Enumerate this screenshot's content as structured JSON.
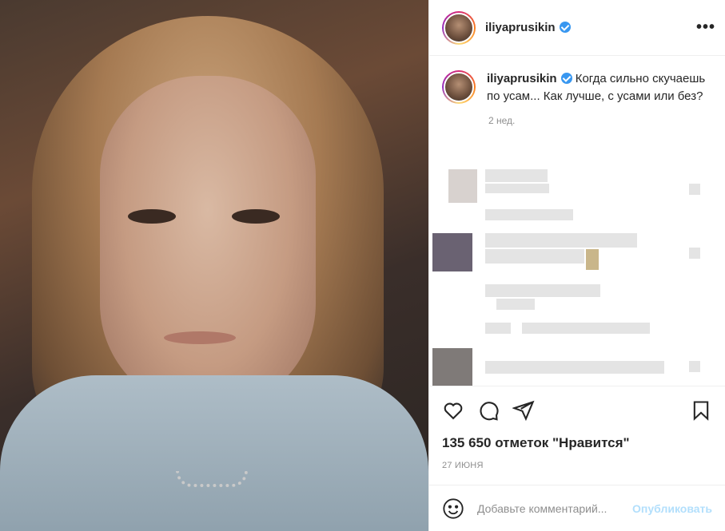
{
  "post": {
    "username": "iliyaprusikin",
    "caption": "Когда сильно скучаешь по усам... Как лучше, с усами или без?",
    "time_ago": "2 нед.",
    "likes_count": "135 650",
    "likes_label": "отметок \"Нравится\"",
    "date": "27 июня",
    "more_label": "•••"
  },
  "comment_box": {
    "placeholder": "Добавьте комментарий...",
    "publish_label": "Опубликовать"
  },
  "icons": [
    "like-icon",
    "comment-icon",
    "share-icon",
    "save-icon",
    "emoji-icon",
    "verified-icon",
    "more-icon"
  ],
  "colors": {
    "verified": "#3897f0",
    "publish_disabled": "#b2dffc",
    "muted": "#8e8e8e"
  }
}
